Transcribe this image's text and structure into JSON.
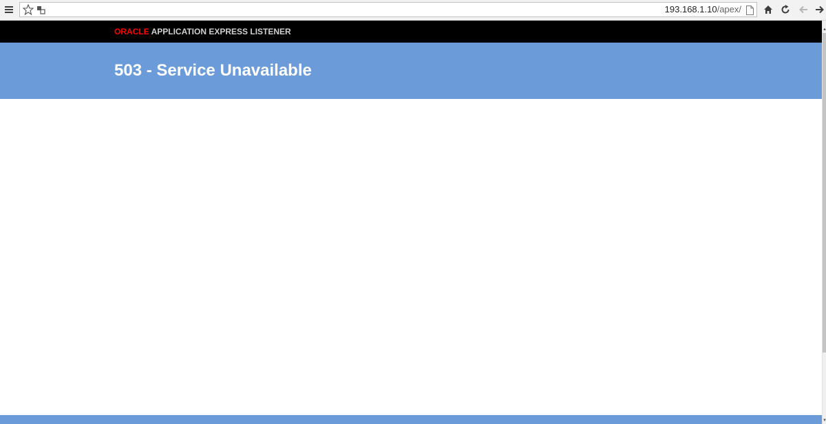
{
  "browser": {
    "url_host": "193.168.1.10",
    "url_path": "/apex/",
    "icons": [
      "menu-icon",
      "star-icon",
      "site-info-icon",
      "page-icon",
      "home-icon",
      "reload-icon",
      "back-icon",
      "forward-icon"
    ]
  },
  "page": {
    "brand_oracle": "ORACLE",
    "brand_product": "APPLICATION EXPRESS LISTENER",
    "error_title": "503 - Service Unavailable"
  },
  "colors": {
    "header_black": "#000000",
    "oracle_red": "#ff0000",
    "title_blue": "#6b9bd9",
    "title_text": "#ffffff"
  }
}
